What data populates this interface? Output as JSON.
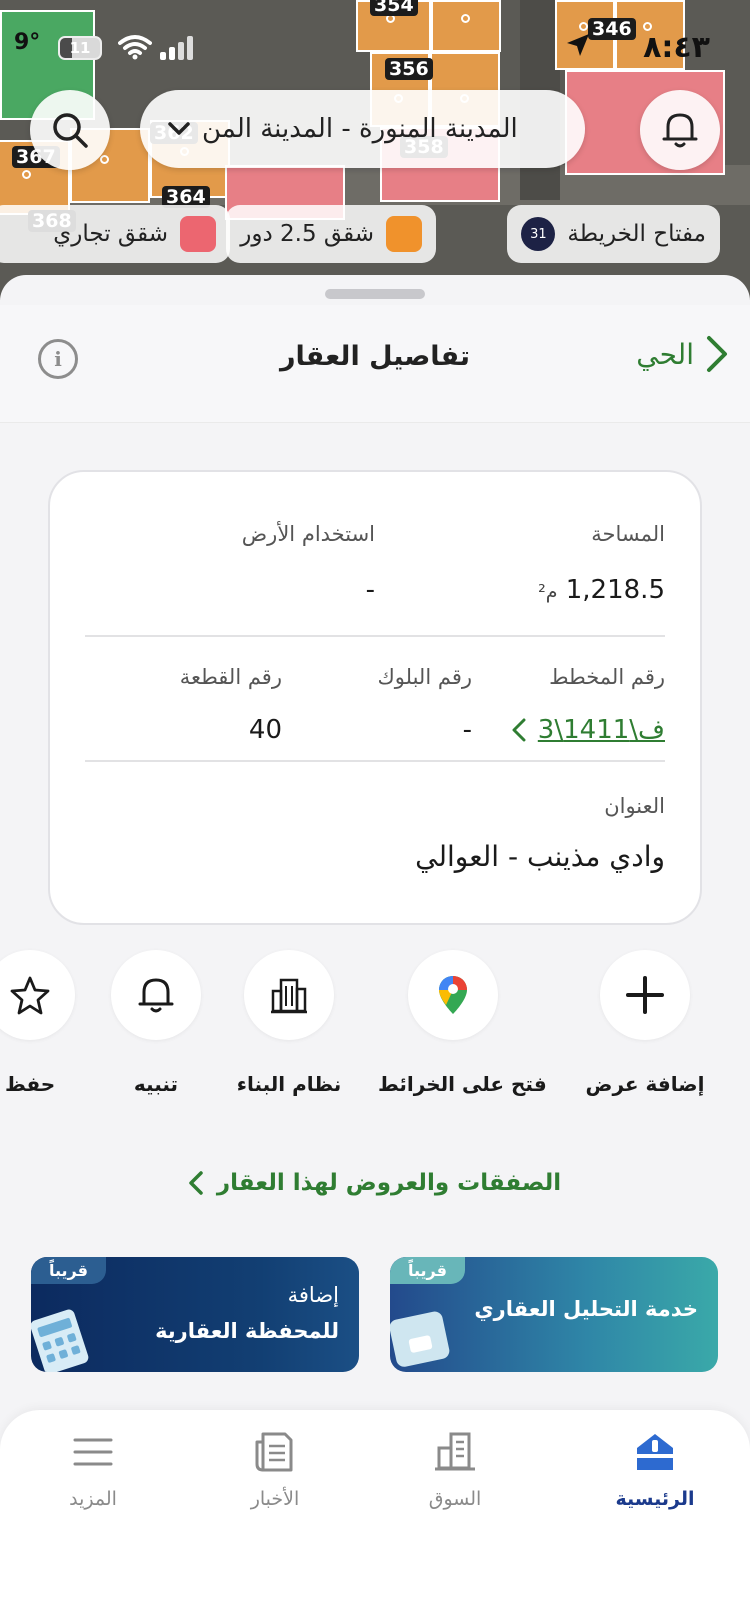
{
  "status_bar": {
    "time": "٨:٤٣",
    "temperature": "9°",
    "battery": "11"
  },
  "map": {
    "plot_numbers": [
      "354",
      "356",
      "346",
      "367",
      "364",
      "368",
      "362",
      "358"
    ],
    "search_icon": "search-icon",
    "notification_icon": "bell-icon",
    "city_select_value": "المدينة المنورة - المدينة المن",
    "legend": {
      "key_label": "مفتاح الخريطة",
      "key_count": "31",
      "apartments_label": "شقق 2.5 دور",
      "apartments_color": "#f0922c",
      "commercial_label": "شقق تجاري",
      "commercial_color": "#ec6670"
    }
  },
  "sheet": {
    "title": "تفاصيل العقار",
    "back_label": "الحي",
    "details": {
      "area_label": "المساحة",
      "area_value": "1,218.5",
      "area_unit": "م²",
      "land_use_label": "استخدام الأرض",
      "land_use_value": "-",
      "plan_label": "رقم المخطط",
      "plan_value": "3\\ف\\1411",
      "block_label": "رقم البلوك",
      "block_value": "-",
      "plot_label": "رقم القطعة",
      "plot_value": "40",
      "address_label": "العنوان",
      "address_value": "وادي مذينب - العوالي"
    },
    "actions": [
      {
        "label": "إضافة عرض",
        "icon": "plus-icon"
      },
      {
        "label": "فتح على الخرائط",
        "icon": "google-maps-pin-icon"
      },
      {
        "label": "نظام البناء",
        "icon": "building-icon"
      },
      {
        "label": "تنبيه",
        "icon": "bell-icon"
      },
      {
        "label": "حفظ",
        "icon": "star-icon"
      }
    ],
    "deals_link": "الصفقات والعروض لهذا العقار",
    "promos": [
      {
        "badge": "قريباً",
        "title": "خدمة التحليل العقاري"
      },
      {
        "badge": "قريباً",
        "title_line1": "إضافة",
        "title_line2": "للمحفظة العقارية"
      }
    ]
  },
  "bottom_nav": {
    "items": [
      {
        "label": "الرئيسية",
        "icon": "home-icon",
        "active": true
      },
      {
        "label": "السوق",
        "icon": "market-building-icon",
        "active": false
      },
      {
        "label": "الأخبار",
        "icon": "news-icon",
        "active": false
      },
      {
        "label": "المزيد",
        "icon": "menu-icon",
        "active": false
      }
    ],
    "active_color": "#1b3a8c"
  }
}
